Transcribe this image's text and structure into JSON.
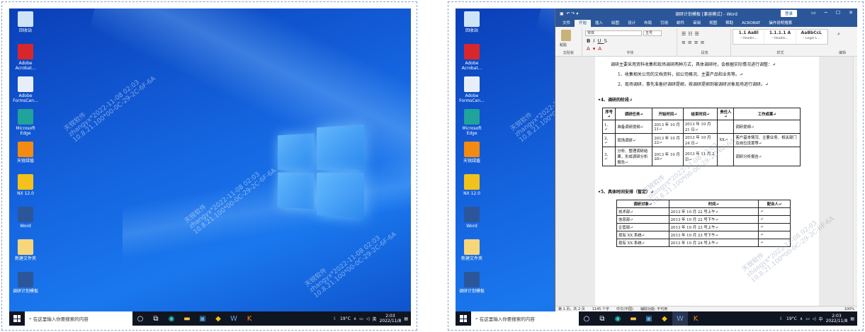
{
  "desktop": {
    "icons": [
      {
        "label": "回收站",
        "color": "#cfe3f7"
      },
      {
        "label": "Adobe Acrobat...",
        "color": "#d8262d"
      },
      {
        "label": "Adobe FormsCen...",
        "color": "#e8eef7"
      },
      {
        "label": "Microsoft Edge",
        "color": "#1fa39a"
      },
      {
        "label": "天锐绿盾",
        "color": "#f38a12"
      },
      {
        "label": "NX 12.0",
        "color": "#f2c21a"
      },
      {
        "label": "Word",
        "color": "#2b579a"
      },
      {
        "label": "新建文件夹",
        "color": "#f6d67a"
      },
      {
        "label": "调研计划模板",
        "color": "#2b579a"
      }
    ],
    "watermark": {
      "line1": "天锐软件",
      "line2": "zhangyx*2022-11-08 02:03",
      "line3": "10.8.21.100*00-0C-29-2C-6F-6A"
    }
  },
  "taskbar": {
    "search_placeholder": "在这里输入你要搜索的内容",
    "weather": "19°C",
    "ime": "英",
    "ime_right": "中",
    "time": "2:03",
    "date": "2022/11/8"
  },
  "word": {
    "title": "调研计划模板 [兼容模式] - Word",
    "login": "登录",
    "tabs": [
      "文件",
      "开始",
      "插入",
      "绘图",
      "设计",
      "布局",
      "引用",
      "邮件",
      "审阅",
      "视图",
      "帮助",
      "ACROBAT",
      "操作说明搜索"
    ],
    "font_name": "宋体",
    "font_size": "五号",
    "group_labels": {
      "clipboard": "剪贴板",
      "font": "字体",
      "paragraph": "段落",
      "styles": "样式",
      "edit": "编辑"
    },
    "paste": "粘贴",
    "styles": [
      {
        "sample": "1.1 AaBl",
        "name": "⁃ Headin..."
      },
      {
        "sample": "1.1.1.1 A",
        "name": "⁃ Headin..."
      },
      {
        "sample": "AaBbCcL",
        "name": "⁃ Legal L..."
      }
    ],
    "doc": {
      "intro": "调研主要采用资料收集和现场调研两种方式，具体调研时，会根据实际情况进行调整：↵",
      "item1": "1、收集相关公司的文档资料，如公司概况、主要产品和业务等。↵",
      "item2": "2、现场调研，事先准备好调研提纲，按调研提纲到被调研对象现场进行调研。↵",
      "section4": "•4、调研的阶段↵",
      "table1_headers": [
        "序号↵",
        "调研任务↵",
        "开始时间↵",
        "结束时间↵",
        "责任人↵",
        "工作成果↵"
      ],
      "table1_rows": [
        [
          "1、↵",
          "准备调研提纲↵",
          "2013 年 10 月 21↵",
          "2013 年 10 月 21 日↵",
          "",
          "调研提纲↵"
        ],
        [
          "2、↵",
          "现场调研↵",
          "2013 年 10 月 22↵",
          "2013 年 10 月 24 日↵",
          "XX↵",
          "客户基本情况、主要业务、相关部门及岗位设置等↵"
        ],
        [
          "3、↵",
          "分析、整理调研结果，形成调研分析报告↵",
          "2013 年 10 月 28↵",
          "2013 年 11 月 2 日↵",
          "",
          "调研分析报告↵"
        ]
      ],
      "section5": "•5、具体时间安排（暂定）↵",
      "table2_headers": [
        "调研对象↵",
        "时间↵",
        "配合人↵"
      ],
      "table2_rows": [
        [
          "技术部↵",
          "2013 年 10 月 22 号上午↵",
          "↵"
        ],
        [
          "信息部↵",
          "2013 年 10 月 22 号下午↵",
          "↵"
        ],
        [
          "企管部↵",
          "2013 年 10 月 23 号上午↵",
          "↵"
        ],
        [
          "现有 XX 系统↵",
          "2013 年 10 月 23 号下午↵",
          "↵"
        ],
        [
          "现有 XX 系统↵",
          "2013 年 10 月 24 号上午↵",
          "↵"
        ]
      ]
    },
    "status": {
      "page": "第 1 页，共 2 页",
      "words": "1145 个字",
      "lang": "中文(中国)",
      "assist": "辅助功能: 不可用",
      "zoom": "100%"
    }
  }
}
